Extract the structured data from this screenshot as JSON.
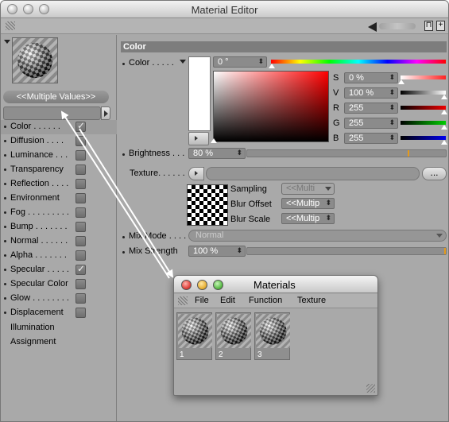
{
  "window": {
    "title": "Material Editor"
  },
  "left_panel": {
    "multiple_values": "<<Multiple Values>>",
    "channels": [
      {
        "label": "Color . . . . . .",
        "checked": true,
        "selected": true
      },
      {
        "label": "Diffusion . . . .",
        "checked": false
      },
      {
        "label": "Luminance . . .",
        "checked": false
      },
      {
        "label": "Transparency",
        "checked": false
      },
      {
        "label": "Reflection . . . .",
        "checked": false
      },
      {
        "label": "Environment",
        "checked": false
      },
      {
        "label": "Fog . . . . . . . . .",
        "checked": false
      },
      {
        "label": "Bump . . . . . . .",
        "checked": false
      },
      {
        "label": "Normal . . . . . .",
        "checked": false
      },
      {
        "label": "Alpha . . . . . . .",
        "checked": false
      },
      {
        "label": "Specular . . . . .",
        "checked": true
      },
      {
        "label": "Specular Color",
        "checked": false
      },
      {
        "label": "Glow . . . . . . . .",
        "checked": false
      },
      {
        "label": "Displacement",
        "checked": false
      }
    ],
    "illumination": "Illumination",
    "assignment": "Assignment"
  },
  "color_section": {
    "title": "Color",
    "color_label": "Color . . . . .",
    "hue_value": "0 °",
    "s_label": "S",
    "s_value": "0 %",
    "v_label": "V",
    "v_value": "100 %",
    "r_label": "R",
    "r_value": "255",
    "g_label": "G",
    "g_value": "255",
    "b_label": "B",
    "b_value": "255",
    "brightness_label": "Brightness . . .",
    "brightness_value": "80 %",
    "texture_label": "Texture. . . . . .",
    "texture_dots": "...",
    "sampling_label": "Sampling",
    "sampling_value": "<<Multi",
    "blur_offset_label": "Blur Offset",
    "blur_offset_value": "<<Multip",
    "blur_scale_label": "Blur Scale",
    "blur_scale_value": "<<Multip",
    "mix_mode_label": "Mix Mode . . . .",
    "mix_mode_value": "Normal",
    "mix_strength_label": "Mix Strength",
    "mix_strength_value": "100 %"
  },
  "materials_window": {
    "title": "Materials",
    "menu": [
      "File",
      "Edit",
      "Function",
      "Texture"
    ],
    "materials": [
      "1",
      "2",
      "3"
    ]
  },
  "colors": {
    "panel_bg": "#a9a9a9",
    "section_bar": "#7d7d7d",
    "arrow": "#ffffff",
    "close_light": "#e0443e",
    "minimize_light": "#e8b33a",
    "zoom_light": "#5dbd4a"
  }
}
